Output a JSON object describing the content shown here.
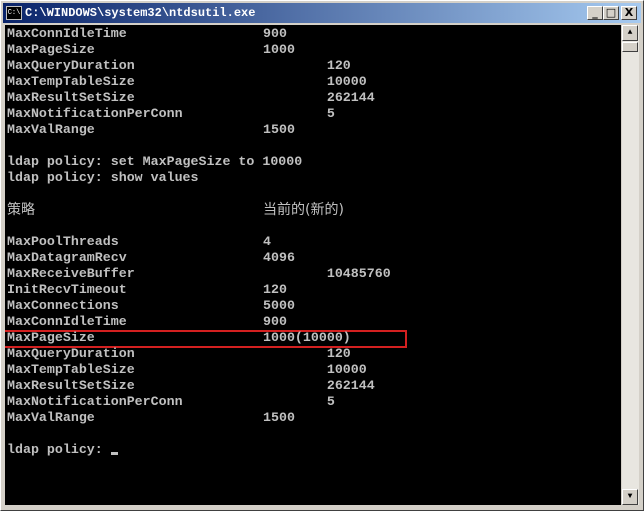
{
  "window": {
    "title": "C:\\WINDOWS\\system32\\ntdsutil.exe",
    "icon": "console-icon",
    "icon_text": "C:\\",
    "minimize": "_",
    "maximize": "□",
    "close": "X"
  },
  "console": {
    "lines": [
      {
        "name": "MaxConnIdleTime",
        "value": "900"
      },
      {
        "name": "MaxPageSize",
        "value": "1000"
      },
      {
        "name": "MaxQueryDuration",
        "value": "        120"
      },
      {
        "name": "MaxTempTableSize",
        "value": "        10000"
      },
      {
        "name": "MaxResultSetSize",
        "value": "        262144"
      },
      {
        "name": "MaxNotificationPerConn",
        "value": "        5"
      },
      {
        "name": "MaxValRange",
        "value": "1500"
      },
      {
        "name": "",
        "value": ""
      },
      {
        "name": "ldap policy: set MaxPageSize to 10000",
        "value": ""
      },
      {
        "name": "ldap policy: show values",
        "value": ""
      },
      {
        "name": "",
        "value": ""
      },
      {
        "name": "策略",
        "value": "当前的(新的)",
        "cjk": true
      },
      {
        "name": "",
        "value": ""
      },
      {
        "name": "MaxPoolThreads",
        "value": "4"
      },
      {
        "name": "MaxDatagramRecv",
        "value": "4096"
      },
      {
        "name": "MaxReceiveBuffer",
        "value": "        10485760"
      },
      {
        "name": "InitRecvTimeout",
        "value": "120"
      },
      {
        "name": "MaxConnections",
        "value": "5000"
      },
      {
        "name": "MaxConnIdleTime",
        "value": "900"
      },
      {
        "name": "MaxPageSize",
        "value": "1000(10000)"
      },
      {
        "name": "MaxQueryDuration",
        "value": "        120"
      },
      {
        "name": "MaxTempTableSize",
        "value": "        10000"
      },
      {
        "name": "MaxResultSetSize",
        "value": "        262144"
      },
      {
        "name": "MaxNotificationPerConn",
        "value": "        5"
      },
      {
        "name": "MaxValRange",
        "value": "1500"
      },
      {
        "name": "",
        "value": ""
      }
    ],
    "prompt": "ldap policy: ",
    "highlight_color": "#d42020"
  }
}
